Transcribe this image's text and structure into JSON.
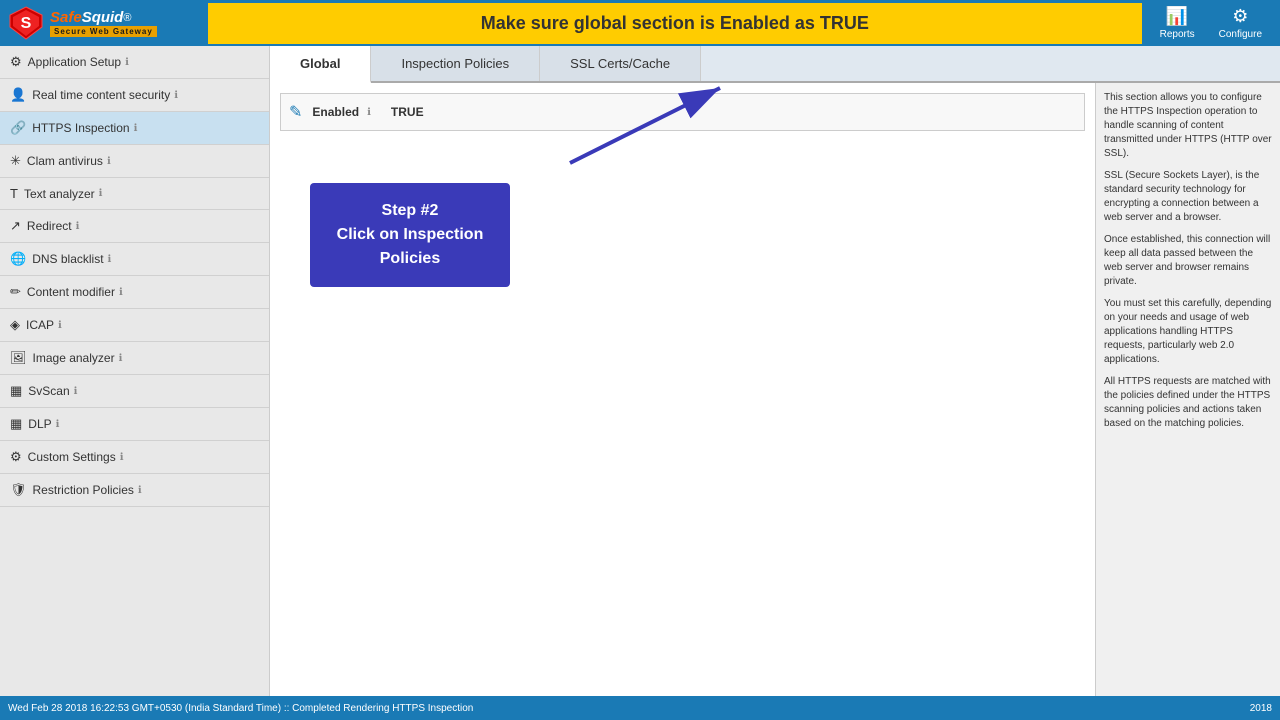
{
  "header": {
    "banner": "Make sure global section is Enabled as TRUE",
    "reports_label": "Reports",
    "configure_label": "Configure"
  },
  "logo": {
    "name": "SafeSquid®",
    "sub": "Secure Web Gateway"
  },
  "sidebar": {
    "items": [
      {
        "id": "application-setup",
        "label": "Application Setup",
        "icon": "⚙",
        "info": true,
        "active": false
      },
      {
        "id": "real-time-content-security",
        "label": "Real time content security",
        "icon": "👤",
        "info": true,
        "active": false
      },
      {
        "id": "https-inspection",
        "label": "HTTPS Inspection",
        "icon": "🔗",
        "info": true,
        "active": true
      },
      {
        "id": "clam-antivirus",
        "label": "Clam antivirus",
        "icon": "✳",
        "info": true,
        "active": false
      },
      {
        "id": "text-analyzer",
        "label": "Text analyzer",
        "icon": "T",
        "info": true,
        "active": false
      },
      {
        "id": "redirect",
        "label": "Redirect",
        "icon": "↗",
        "info": true,
        "active": false
      },
      {
        "id": "dns-blacklist",
        "label": "DNS blacklist",
        "icon": "🌐",
        "info": true,
        "active": false
      },
      {
        "id": "content-modifier",
        "label": "Content modifier",
        "icon": "✏",
        "info": true,
        "active": false
      },
      {
        "id": "icap",
        "label": "ICAP",
        "icon": "◈",
        "info": true,
        "active": false
      },
      {
        "id": "image-analyzer",
        "label": "Image analyzer",
        "icon": "🖼",
        "info": true,
        "active": false
      },
      {
        "id": "svscan",
        "label": "SvScan",
        "icon": "▦",
        "info": true,
        "active": false
      },
      {
        "id": "dlp",
        "label": "DLP",
        "icon": "▦",
        "info": true,
        "active": false
      },
      {
        "id": "custom-settings",
        "label": "Custom Settings",
        "icon": "⚙",
        "info": true,
        "active": false
      },
      {
        "id": "restriction-policies",
        "label": "Restriction Policies",
        "icon": "🛡",
        "info": true,
        "active": false
      }
    ]
  },
  "tabs": [
    {
      "id": "global",
      "label": "Global",
      "active": true
    },
    {
      "id": "inspection-policies",
      "label": "Inspection Policies",
      "active": false
    },
    {
      "id": "ssl-certs-cache",
      "label": "SSL Certs/Cache",
      "active": false
    }
  ],
  "global_panel": {
    "enabled_label": "Enabled",
    "enabled_info": true,
    "enabled_value": "TRUE",
    "edit_icon": "✎"
  },
  "callout": {
    "step": "Step #2",
    "line1": "Click on Inspection",
    "line2": "Policies"
  },
  "right_panel": {
    "paragraphs": [
      "This section allows you to configure the HTTPS Inspection operation to handle scanning of content transmitted under HTTPS (HTTP over SSL).",
      "SSL (Secure Sockets Layer), is the standard security technology for encrypting a connection between a web server and a browser.",
      "Once established, this connection will keep all data passed between the web server and browser remains private.",
      "You must set this carefully, depending on your needs and usage of web applications handling HTTPS requests, particularly web 2.0 applications.",
      "All HTTPS requests are matched with the policies defined under the HTTPS scanning policies and actions taken based on the matching policies."
    ]
  },
  "statusbar": {
    "left": "Wed Feb 28 2018 16:22:53 GMT+0530 (India Standard Time) :: Completed Rendering HTTPS Inspection",
    "right": "2018"
  }
}
